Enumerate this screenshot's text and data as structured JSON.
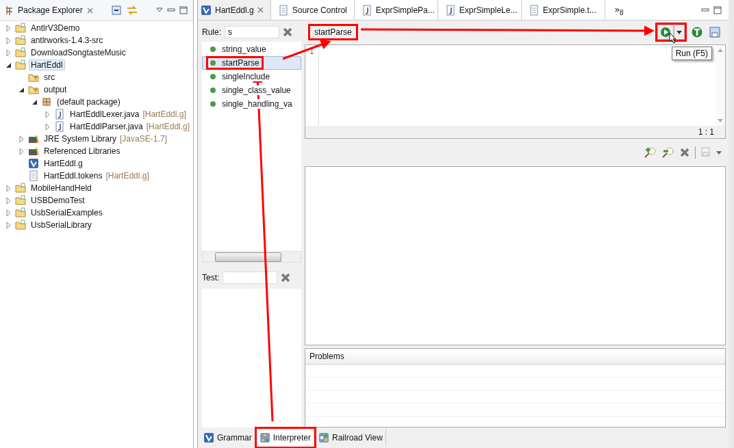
{
  "explorer": {
    "title": "Package Explorer",
    "tree": [
      {
        "label": "AntlrV3Demo",
        "kind": "project",
        "expanded": false,
        "selected": false
      },
      {
        "label": "antlrworks-1.4.3-src",
        "kind": "project",
        "expanded": false,
        "selected": false
      },
      {
        "label": "DownloadSongtasteMusic",
        "kind": "project",
        "expanded": false,
        "selected": false
      },
      {
        "label": "HartEddl",
        "kind": "project",
        "expanded": true,
        "selected": true,
        "children": [
          {
            "label": "src",
            "kind": "folder",
            "selected": false
          },
          {
            "label": "output",
            "kind": "folder",
            "expanded": true,
            "selected": false,
            "children": [
              {
                "label": "(default package)",
                "kind": "package",
                "expanded": true,
                "selected": false,
                "children": [
                  {
                    "label": "HartEddlLexer.java",
                    "decoration": "[HartEddl.g]",
                    "kind": "java",
                    "expanded": false,
                    "selected": false
                  },
                  {
                    "label": "HartEddlParser.java",
                    "decoration": "[HartEddl.g]",
                    "kind": "java",
                    "expanded": false,
                    "selected": false
                  }
                ]
              }
            ]
          },
          {
            "label": "JRE System Library",
            "decoration": "[JavaSE-1.7]",
            "kind": "library",
            "expanded": false,
            "selected": false
          },
          {
            "label": "Referenced Libraries",
            "kind": "library",
            "expanded": false,
            "selected": false
          },
          {
            "label": "HartEddl.g",
            "kind": "grammar",
            "selected": false
          },
          {
            "label": "HartEddl.tokens",
            "decoration": "[HartEddl.g]",
            "kind": "file",
            "selected": false
          }
        ]
      },
      {
        "label": "MobileHandHeld",
        "kind": "project",
        "expanded": false,
        "selected": false
      },
      {
        "label": "USBDemoTest",
        "kind": "project",
        "expanded": false,
        "selected": false
      },
      {
        "label": "UsbSerialExamples",
        "kind": "project",
        "expanded": false,
        "selected": false
      },
      {
        "label": "UsbSerialLibrary",
        "kind": "project",
        "expanded": false,
        "selected": false
      }
    ]
  },
  "editor_tabs": [
    {
      "label": "HartEddl.g",
      "kind": "grammar",
      "selected": true
    },
    {
      "label": "Source Control",
      "kind": "file",
      "selected": false
    },
    {
      "label": "ExprSimplePa...",
      "kind": "java",
      "selected": false
    },
    {
      "label": "ExprSimpleLe...",
      "kind": "java",
      "selected": false
    },
    {
      "label": "ExprSimple.t...",
      "kind": "file",
      "selected": false
    }
  ],
  "overflow": {
    "glyph": "»",
    "count": "8"
  },
  "rule_filter": {
    "label": "Rule:",
    "value": "s"
  },
  "rules": [
    {
      "label": "string_value",
      "selected": false,
      "highlighted": false
    },
    {
      "label": "startParse",
      "selected": true,
      "highlighted": true
    },
    {
      "label": "singleInclude",
      "selected": false,
      "highlighted": false
    },
    {
      "label": "single_class_value",
      "selected": false,
      "highlighted": false
    },
    {
      "label": "single_handling_va",
      "selected": false,
      "highlighted": false
    }
  ],
  "current_rule": {
    "label": "startParse",
    "highlighted": true
  },
  "run_button": {
    "highlighted": true,
    "tooltip": "Run (F5)"
  },
  "input_editor": {
    "line_number": "1",
    "position": "1 : 1"
  },
  "test_filter": {
    "label": "Test:"
  },
  "problems": {
    "title": "Problems"
  },
  "bottom_tabs": [
    {
      "label": "Grammar",
      "kind": "grammar",
      "selected": false,
      "highlighted": false
    },
    {
      "label": "Interpreter",
      "kind": "interpreter",
      "selected": true,
      "highlighted": true
    },
    {
      "label": "Railroad View",
      "kind": "railroad",
      "selected": false,
      "highlighted": false
    }
  ]
}
